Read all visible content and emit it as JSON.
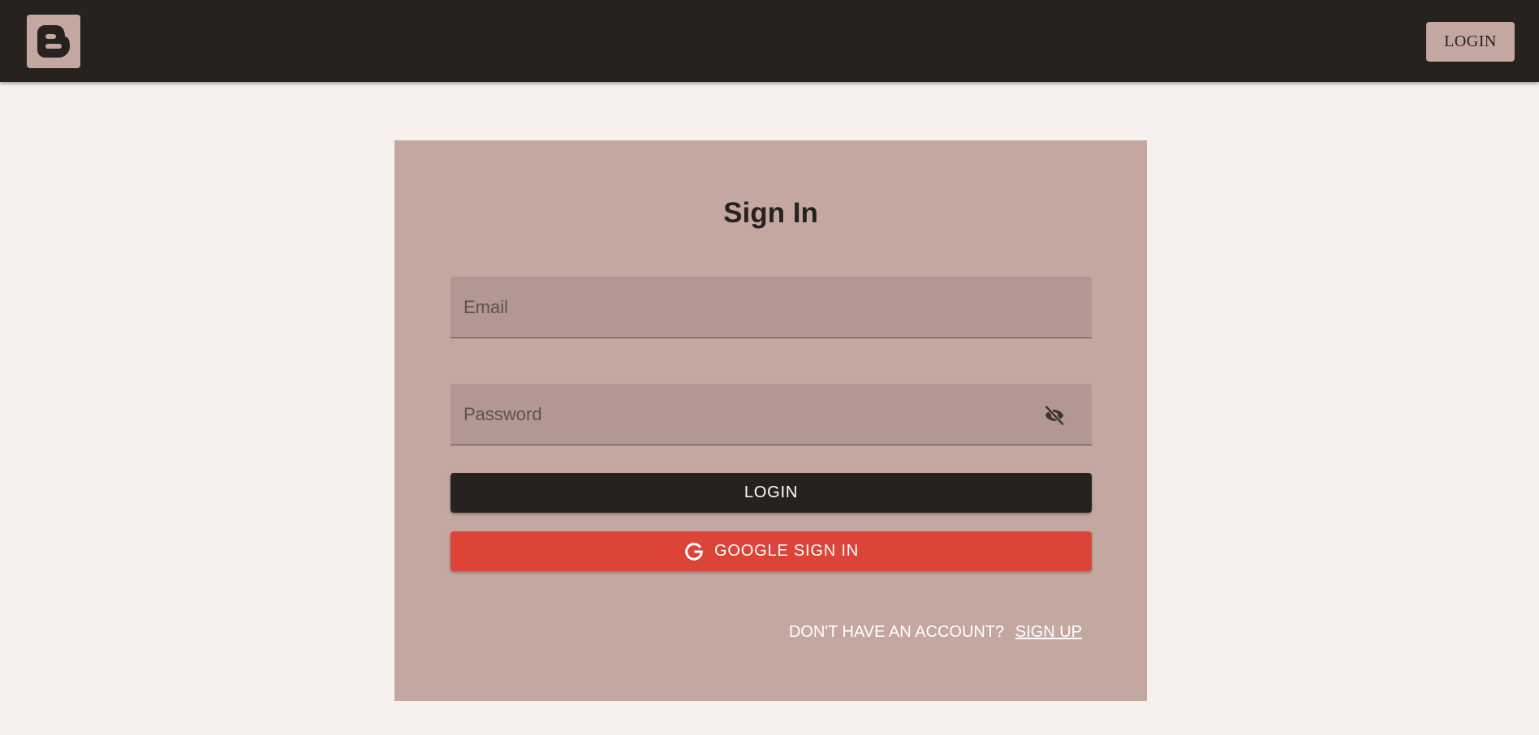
{
  "header": {
    "logo_icon": "blogger-logo-icon",
    "login_label": "LOGIN"
  },
  "signin": {
    "title": "Sign In",
    "email_placeholder": "Email",
    "email_value": "",
    "password_placeholder": "Password",
    "password_value": "",
    "password_toggle_icon": "eye-off-icon",
    "login_label": "LOGIN",
    "google_label": "GOOGLE SIGN IN",
    "google_icon": "google-icon",
    "no_account_text": "DON'T HAVE AN ACCOUNT?",
    "signup_label": "SIGN UP"
  },
  "colors": {
    "topbar": "#262220",
    "page_background": "#f6f1ef",
    "card": "#c4a7a1",
    "input_fill": "#b29792",
    "login_button": "#262220",
    "google_button": "#dc4438"
  }
}
